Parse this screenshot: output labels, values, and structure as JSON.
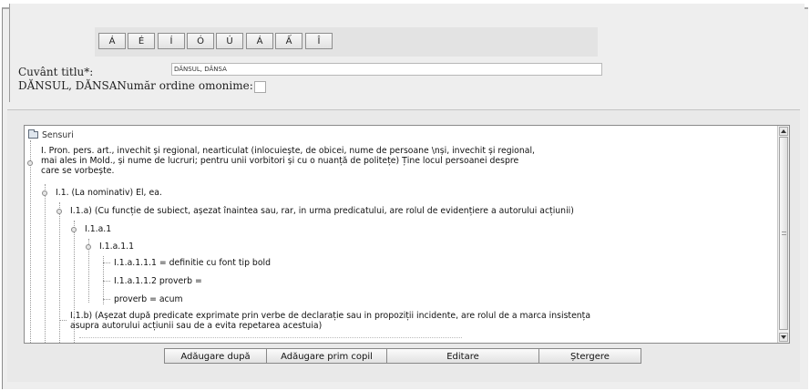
{
  "char_buttons": [
    "Á",
    "É",
    "Í",
    "Ó",
    "Ú",
    "Á",
    "Ấ",
    "Î"
  ],
  "title_label": "Cuvânt titlu*:",
  "title_value": "DĂNSUL, DĂNSA",
  "headword_display": "DĂNSUL, DĂNSA",
  "homonym_label": "Număr ordine omonime:",
  "tree": {
    "root_label": "Sensuri",
    "nodes": [
      {
        "text": "I. Pron. pers. art., invechit și regional, nearticulat (inlocuiește, de obicei, nume de persoane \\nși, invechit și regional,\nmai ales in Mold., și nume de lucruri; pentru unii vorbitori și cu o nuanță de politețe) Ține locul persoanei despre\ncare se vorbește."
      },
      {
        "text": "I.1. (La nominativ) El, ea."
      },
      {
        "text": "I.1.a) (Cu funcție de subiect, așezat înaintea sau, rar, in urma predicatului, are rolul de evidențiere a autorului acțiunii)"
      },
      {
        "text": "I.1.a.1"
      },
      {
        "text": "I.1.a.1.1"
      },
      {
        "text": "I.1.a.1.1.1 = definitie cu font tip bold"
      },
      {
        "text": "I.1.a.1.1.2 proverb ="
      },
      {
        "text": "proverb = acum"
      },
      {
        "text": "I.1.b) (Așezat după predicate exprimate prin verbe de declarație sau in propoziții incidente, are rolul de a marca insistența\nasupra autorului acțiunii sau de a evita repetarea acestuia)"
      }
    ]
  },
  "actions": {
    "add_after": "Adăugare după",
    "add_first_child": "Adăugare prim copil",
    "edit": "Editare",
    "delete": "Ștergere"
  }
}
